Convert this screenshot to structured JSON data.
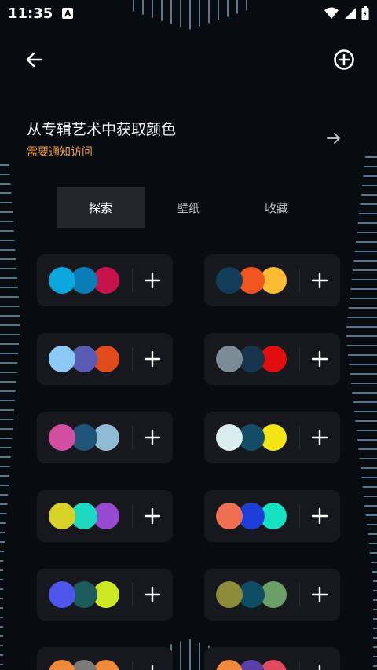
{
  "status_bar": {
    "time": "11:35",
    "notification_letter": "A"
  },
  "album_banner": {
    "title": "从专辑艺术中获取颜色",
    "subtitle": "需要通知访问"
  },
  "tabs": [
    {
      "label": "探索",
      "active": true
    },
    {
      "label": "壁纸",
      "active": false
    },
    {
      "label": "收藏",
      "active": false
    }
  ],
  "colors": {
    "accent_orange": "#f0a23b",
    "card_bg": "#17181d",
    "tick_blue": "#8fc7e6"
  },
  "palettes": [
    {
      "colors": [
        "#0aa6dc",
        "#0b7db6",
        "#c8124e"
      ]
    },
    {
      "colors": [
        "#123e5a",
        "#f0541f",
        "#fbbb33"
      ]
    },
    {
      "colors": [
        "#8ccaf5",
        "#5b5bb4",
        "#e04a1c"
      ]
    },
    {
      "colors": [
        "#7b8c97",
        "#17354d",
        "#e40d0d"
      ]
    },
    {
      "colors": [
        "#d14ea1",
        "#1f5478",
        "#8fbcd4"
      ]
    },
    {
      "colors": [
        "#d9ecee",
        "#124c66",
        "#f3e414"
      ]
    },
    {
      "colors": [
        "#d8d226",
        "#1dd9c1",
        "#9749d2"
      ]
    },
    {
      "colors": [
        "#ee6f52",
        "#1c3dd7",
        "#14e0c2"
      ]
    },
    {
      "colors": [
        "#4d55ea",
        "#1d5a5c",
        "#cde823"
      ]
    },
    {
      "colors": [
        "#8c8a3b",
        "#0e4c61",
        "#6b9f67"
      ]
    },
    {
      "colors": [
        "#f08a3a",
        "#7a7a7a",
        "#f08a3a"
      ]
    },
    {
      "colors": [
        "#f08a3a",
        "#5b3fa8",
        "#e04a5c"
      ]
    }
  ],
  "icons": {
    "back": "arrow-left-icon",
    "add": "plus-circle-icon",
    "banner_arrow": "arrow-right-icon",
    "palette_add": "plus-icon"
  }
}
